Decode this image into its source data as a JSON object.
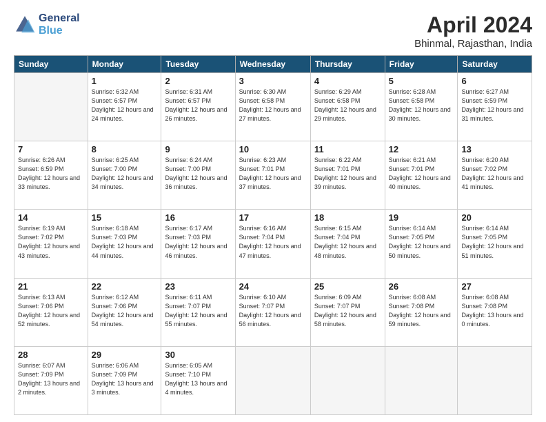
{
  "header": {
    "logo_line1": "General",
    "logo_line2": "Blue",
    "title": "April 2024",
    "subtitle": "Bhinmal, Rajasthan, India"
  },
  "weekdays": [
    "Sunday",
    "Monday",
    "Tuesday",
    "Wednesday",
    "Thursday",
    "Friday",
    "Saturday"
  ],
  "weeks": [
    [
      {
        "day": "",
        "info": ""
      },
      {
        "day": "1",
        "info": "Sunrise: 6:32 AM\nSunset: 6:57 PM\nDaylight: 12 hours\nand 24 minutes."
      },
      {
        "day": "2",
        "info": "Sunrise: 6:31 AM\nSunset: 6:57 PM\nDaylight: 12 hours\nand 26 minutes."
      },
      {
        "day": "3",
        "info": "Sunrise: 6:30 AM\nSunset: 6:58 PM\nDaylight: 12 hours\nand 27 minutes."
      },
      {
        "day": "4",
        "info": "Sunrise: 6:29 AM\nSunset: 6:58 PM\nDaylight: 12 hours\nand 29 minutes."
      },
      {
        "day": "5",
        "info": "Sunrise: 6:28 AM\nSunset: 6:58 PM\nDaylight: 12 hours\nand 30 minutes."
      },
      {
        "day": "6",
        "info": "Sunrise: 6:27 AM\nSunset: 6:59 PM\nDaylight: 12 hours\nand 31 minutes."
      }
    ],
    [
      {
        "day": "7",
        "info": "Sunrise: 6:26 AM\nSunset: 6:59 PM\nDaylight: 12 hours\nand 33 minutes."
      },
      {
        "day": "8",
        "info": "Sunrise: 6:25 AM\nSunset: 7:00 PM\nDaylight: 12 hours\nand 34 minutes."
      },
      {
        "day": "9",
        "info": "Sunrise: 6:24 AM\nSunset: 7:00 PM\nDaylight: 12 hours\nand 36 minutes."
      },
      {
        "day": "10",
        "info": "Sunrise: 6:23 AM\nSunset: 7:01 PM\nDaylight: 12 hours\nand 37 minutes."
      },
      {
        "day": "11",
        "info": "Sunrise: 6:22 AM\nSunset: 7:01 PM\nDaylight: 12 hours\nand 39 minutes."
      },
      {
        "day": "12",
        "info": "Sunrise: 6:21 AM\nSunset: 7:01 PM\nDaylight: 12 hours\nand 40 minutes."
      },
      {
        "day": "13",
        "info": "Sunrise: 6:20 AM\nSunset: 7:02 PM\nDaylight: 12 hours\nand 41 minutes."
      }
    ],
    [
      {
        "day": "14",
        "info": "Sunrise: 6:19 AM\nSunset: 7:02 PM\nDaylight: 12 hours\nand 43 minutes."
      },
      {
        "day": "15",
        "info": "Sunrise: 6:18 AM\nSunset: 7:03 PM\nDaylight: 12 hours\nand 44 minutes."
      },
      {
        "day": "16",
        "info": "Sunrise: 6:17 AM\nSunset: 7:03 PM\nDaylight: 12 hours\nand 46 minutes."
      },
      {
        "day": "17",
        "info": "Sunrise: 6:16 AM\nSunset: 7:04 PM\nDaylight: 12 hours\nand 47 minutes."
      },
      {
        "day": "18",
        "info": "Sunrise: 6:15 AM\nSunset: 7:04 PM\nDaylight: 12 hours\nand 48 minutes."
      },
      {
        "day": "19",
        "info": "Sunrise: 6:14 AM\nSunset: 7:05 PM\nDaylight: 12 hours\nand 50 minutes."
      },
      {
        "day": "20",
        "info": "Sunrise: 6:14 AM\nSunset: 7:05 PM\nDaylight: 12 hours\nand 51 minutes."
      }
    ],
    [
      {
        "day": "21",
        "info": "Sunrise: 6:13 AM\nSunset: 7:06 PM\nDaylight: 12 hours\nand 52 minutes."
      },
      {
        "day": "22",
        "info": "Sunrise: 6:12 AM\nSunset: 7:06 PM\nDaylight: 12 hours\nand 54 minutes."
      },
      {
        "day": "23",
        "info": "Sunrise: 6:11 AM\nSunset: 7:07 PM\nDaylight: 12 hours\nand 55 minutes."
      },
      {
        "day": "24",
        "info": "Sunrise: 6:10 AM\nSunset: 7:07 PM\nDaylight: 12 hours\nand 56 minutes."
      },
      {
        "day": "25",
        "info": "Sunrise: 6:09 AM\nSunset: 7:07 PM\nDaylight: 12 hours\nand 58 minutes."
      },
      {
        "day": "26",
        "info": "Sunrise: 6:08 AM\nSunset: 7:08 PM\nDaylight: 12 hours\nand 59 minutes."
      },
      {
        "day": "27",
        "info": "Sunrise: 6:08 AM\nSunset: 7:08 PM\nDaylight: 13 hours\nand 0 minutes."
      }
    ],
    [
      {
        "day": "28",
        "info": "Sunrise: 6:07 AM\nSunset: 7:09 PM\nDaylight: 13 hours\nand 2 minutes."
      },
      {
        "day": "29",
        "info": "Sunrise: 6:06 AM\nSunset: 7:09 PM\nDaylight: 13 hours\nand 3 minutes."
      },
      {
        "day": "30",
        "info": "Sunrise: 6:05 AM\nSunset: 7:10 PM\nDaylight: 13 hours\nand 4 minutes."
      },
      {
        "day": "",
        "info": ""
      },
      {
        "day": "",
        "info": ""
      },
      {
        "day": "",
        "info": ""
      },
      {
        "day": "",
        "info": ""
      }
    ]
  ]
}
